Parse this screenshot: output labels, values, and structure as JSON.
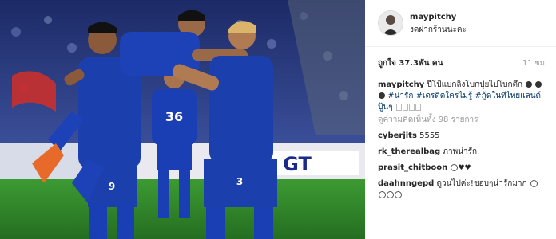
{
  "post": {
    "username": "maypitchy",
    "location": "งดฝากร้านนะคะ",
    "likes": "ถูกใจ 37.3พัน คน",
    "time_ago": "11 ชม."
  },
  "caption": {
    "username": "maypitchy",
    "text": "ปีโป้แบกลิงโบกปุยไปโบกตึก",
    "hashtags": [
      "#น่ารัก",
      "#เดรดิตใครไม่รู้",
      "#กู้ดในทีไทยแลนด์ปู้นๆ"
    ]
  },
  "view_all_comments": "ดูความคิดเห็นทั้ง 98 รายการ",
  "comments": [
    {
      "username": "cyberjits",
      "text": "5555"
    },
    {
      "username": "rk_therealbag",
      "text": "ภาพน่ารัก"
    },
    {
      "username": "prasit_chitboon",
      "text": ""
    },
    {
      "username": "daahnngepd",
      "text": "ดูวนไปค่ะ!ชอบๆน่ารักมาก"
    }
  ],
  "photo": {
    "jersey_numbers": [
      "36",
      "9",
      "3"
    ],
    "sponsor_text": "GT",
    "colors": {
      "jersey": "#1a3fb5",
      "pitch": "#2f8a2a",
      "crowd": "#2a3a7a",
      "board": "#e9e9ef"
    }
  },
  "colors": {
    "text": "#262626",
    "muted": "#999999",
    "link": "#003569"
  }
}
